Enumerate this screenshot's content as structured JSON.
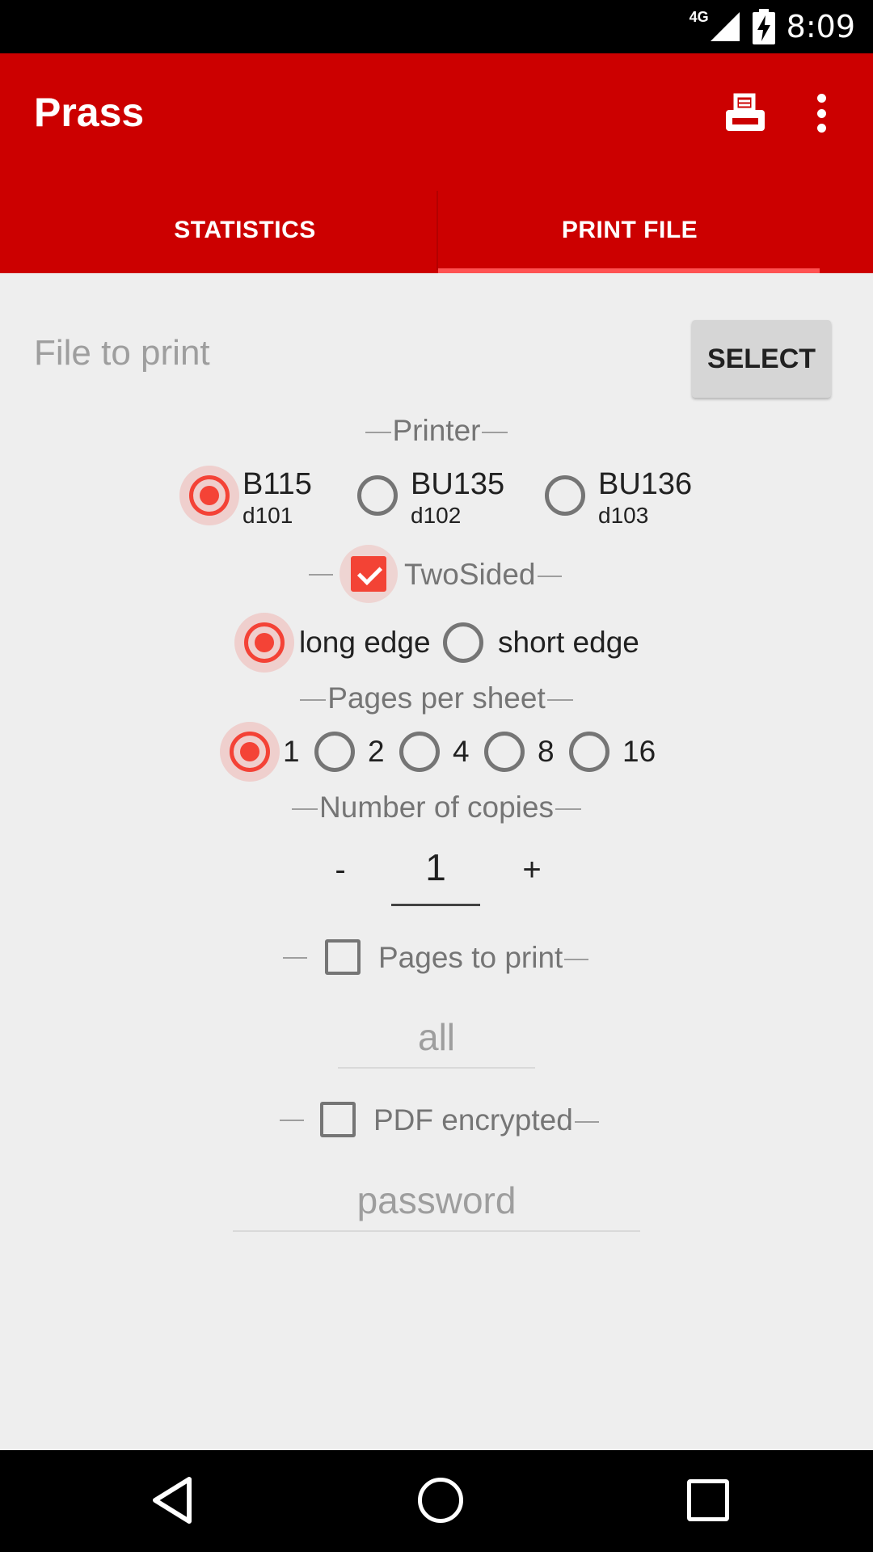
{
  "status_bar": {
    "network": "4G",
    "time": "8:09"
  },
  "app_bar": {
    "title": "Prass",
    "actions": [
      "print-icon",
      "more-vert-icon"
    ],
    "tabs": [
      {
        "label": "STATISTICS",
        "selected": false
      },
      {
        "label": "PRINT FILE",
        "selected": true
      }
    ],
    "colors": {
      "primary": "#cc0000",
      "accent": "#f44336"
    }
  },
  "file": {
    "label": "File to print",
    "select_button": "SELECT"
  },
  "printer": {
    "label": "Printer",
    "options": [
      {
        "name": "B115",
        "room": "d101",
        "selected": true
      },
      {
        "name": "BU135",
        "room": "d102",
        "selected": false
      },
      {
        "name": "BU136",
        "room": "d103",
        "selected": false
      }
    ]
  },
  "two_sided": {
    "label": "TwoSided",
    "checked": true,
    "options": [
      {
        "label": "long edge",
        "selected": true
      },
      {
        "label": "short edge",
        "selected": false
      }
    ]
  },
  "pages_per_sheet": {
    "label": "Pages per sheet",
    "options": [
      {
        "label": "1",
        "selected": true
      },
      {
        "label": "2",
        "selected": false
      },
      {
        "label": "4",
        "selected": false
      },
      {
        "label": "8",
        "selected": false
      },
      {
        "label": "16",
        "selected": false
      }
    ]
  },
  "copies": {
    "label": "Number of copies",
    "decrement": "-",
    "value": "1",
    "increment": "+"
  },
  "pages_to_print": {
    "label": "Pages to print",
    "checked": false,
    "placeholder": "all"
  },
  "pdf_encrypted": {
    "label": "PDF encrypted",
    "checked": false,
    "placeholder": "password"
  },
  "nav_bar": [
    "back-icon",
    "home-icon",
    "recents-icon"
  ]
}
